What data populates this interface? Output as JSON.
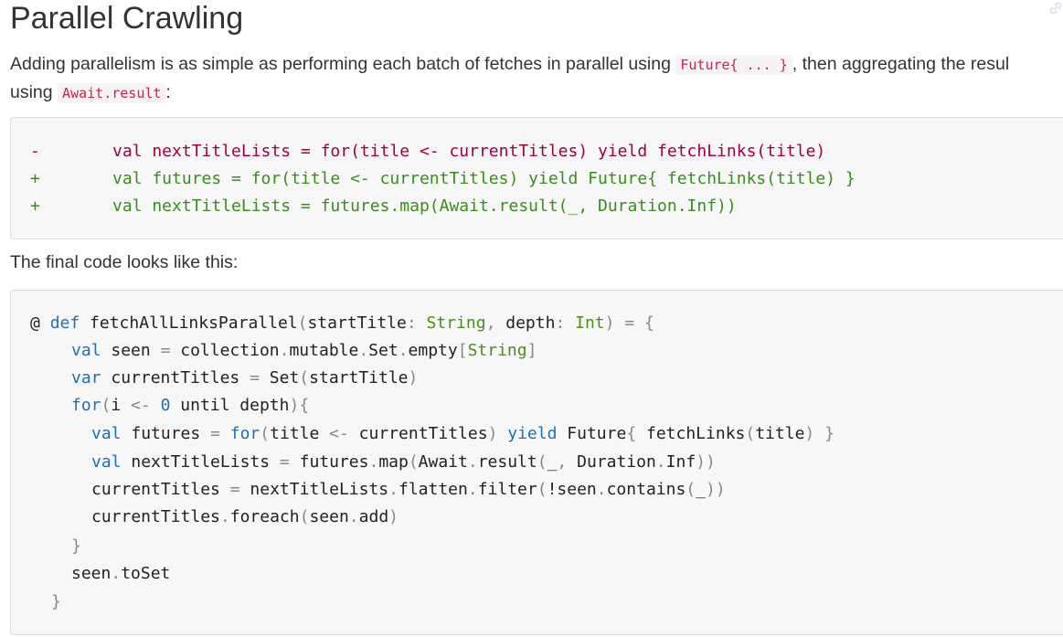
{
  "heading": "Parallel Crawling",
  "intro": {
    "text1": "Adding parallelism is as simple as performing each batch of fetches in parallel using ",
    "code1": "Future{ ... }",
    "text2": ", then aggregating the resul",
    "text3": "using ",
    "code2": "Await.result",
    "text4": ":"
  },
  "diff": {
    "lines": [
      {
        "mark": "-",
        "code": "val nextTitleLists = for(title <- currentTitles) yield fetchLinks(title)"
      },
      {
        "mark": "+",
        "code": "val futures = for(title <- currentTitles) yield Future{ fetchLinks(title) }"
      },
      {
        "mark": "+",
        "code": "val nextTitleLists = futures.map(Await.result(_, Duration.Inf))"
      }
    ]
  },
  "final_intro": "The final code looks like this:",
  "code": {
    "line1": {
      "at": "@",
      "def": "def",
      "name": "fetchAllLinksParallel",
      "p1": "(",
      "a1": "startTitle",
      "c1": ":",
      "t1": "String",
      "cm": ",",
      "a2": "depth",
      "c2": ":",
      "t2": "Int",
      "p2": ")",
      "eq": "=",
      "br": "{"
    },
    "line2": {
      "kw": "val",
      "name": "seen",
      "eq": "=",
      "a": "collection",
      "d1": ".",
      "b": "mutable",
      "d2": ".",
      "c": "Set",
      "d3": ".",
      "d": "empty",
      "lb": "[",
      "t": "String",
      "rb": "]"
    },
    "line3": {
      "kw": "var",
      "name": "currentTitles",
      "eq": "=",
      "a": "Set",
      "lp": "(",
      "b": "startTitle",
      "rp": ")"
    },
    "line4": {
      "kw": "for",
      "lp": "(",
      "a": "i",
      "arrow": "<-",
      "num": "0",
      "b": "until depth",
      "rp": ")",
      "br": "{"
    },
    "line5": {
      "kw": "val",
      "name": "futures",
      "eq": "=",
      "kw2": "for",
      "lp": "(",
      "a": "title",
      "arrow": "<-",
      "b": "currentTitles",
      "rp": ")",
      "kw3": "yield",
      "c": "Future",
      "lb": "{",
      "d": "fetchLinks",
      "lp2": "(",
      "e": "title",
      "rp2": ")",
      "rb": "}"
    },
    "line6": {
      "kw": "val",
      "name": "nextTitleLists",
      "eq": "=",
      "a": "futures",
      "d1": ".",
      "b": "map",
      "lp": "(",
      "c": "Await",
      "d2": ".",
      "d": "result",
      "lp2": "(",
      "e": "_",
      "cm": ",",
      "f": "Duration",
      "d3": ".",
      "g": "Inf",
      "rp": "))"
    },
    "line7": {
      "a": "currentTitles",
      "eq": "=",
      "b": "nextTitleLists",
      "d1": ".",
      "c": "flatten",
      "d2": ".",
      "d": "filter",
      "lp": "(",
      "e": "!seen",
      "d3": ".",
      "f": "contains",
      "lp2": "(",
      "g": "_",
      "rp": "))"
    },
    "line8": {
      "a": "currentTitles",
      "d1": ".",
      "b": "foreach",
      "lp": "(",
      "c": "seen",
      "d2": ".",
      "d": "add",
      "rp": ")"
    },
    "line9": {
      "br": "}"
    },
    "line10": {
      "a": "seen",
      "d1": ".",
      "b": "toSet"
    },
    "line11": {
      "br": "}"
    }
  }
}
